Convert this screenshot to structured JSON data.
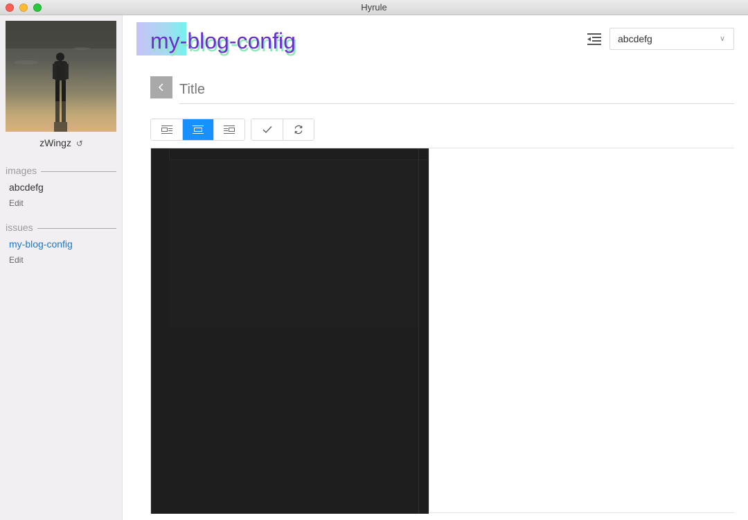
{
  "window": {
    "title": "Hyrule"
  },
  "sidebar": {
    "username": "zWingz",
    "sections": [
      {
        "title": "images",
        "item": "abcdefg",
        "edit": "Edit",
        "active": false
      },
      {
        "title": "issues",
        "item": "my-blog-config",
        "edit": "Edit",
        "active": true
      }
    ]
  },
  "main": {
    "repo_title": "my-blog-config",
    "repo_select": {
      "value": "abcdefg"
    },
    "title_placeholder": "Title",
    "layout_buttons": [
      {
        "icon": "layout-editor-only-icon",
        "active": false
      },
      {
        "icon": "layout-split-icon",
        "active": true
      },
      {
        "icon": "layout-preview-only-icon",
        "active": false
      }
    ],
    "action_buttons": [
      {
        "icon": "check-icon"
      },
      {
        "icon": "sync-icon"
      }
    ]
  },
  "colors": {
    "accent": "#1890ff",
    "link_active": "#1677d6",
    "repo_title": "#6a2fcf",
    "editor_bg": "#1e1e1e"
  }
}
